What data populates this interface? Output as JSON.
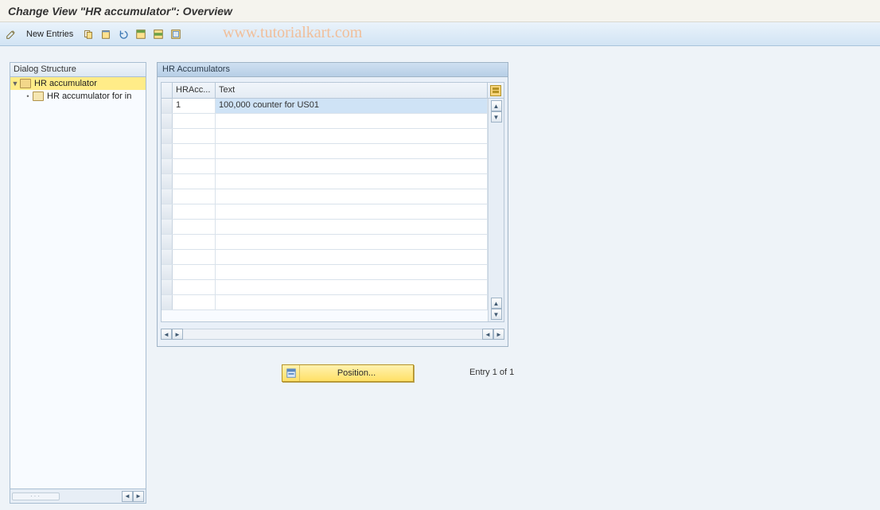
{
  "title": "Change View \"HR accumulator\": Overview",
  "toolbar": {
    "new_entries_label": "New Entries"
  },
  "watermark": "www.tutorialkart.com",
  "dialog": {
    "header": "Dialog Structure",
    "items": [
      {
        "label": "HR accumulator"
      },
      {
        "label": "HR accumulator for in"
      }
    ]
  },
  "hr_panel": {
    "title": "HR Accumulators",
    "columns": {
      "col1": "HRAcc...",
      "col2": "Text"
    },
    "rows": [
      {
        "c1": "1",
        "c2": "100,000 counter for US01"
      }
    ]
  },
  "position": {
    "label": "Position..."
  },
  "status": {
    "entry_text": "Entry 1 of 1"
  }
}
